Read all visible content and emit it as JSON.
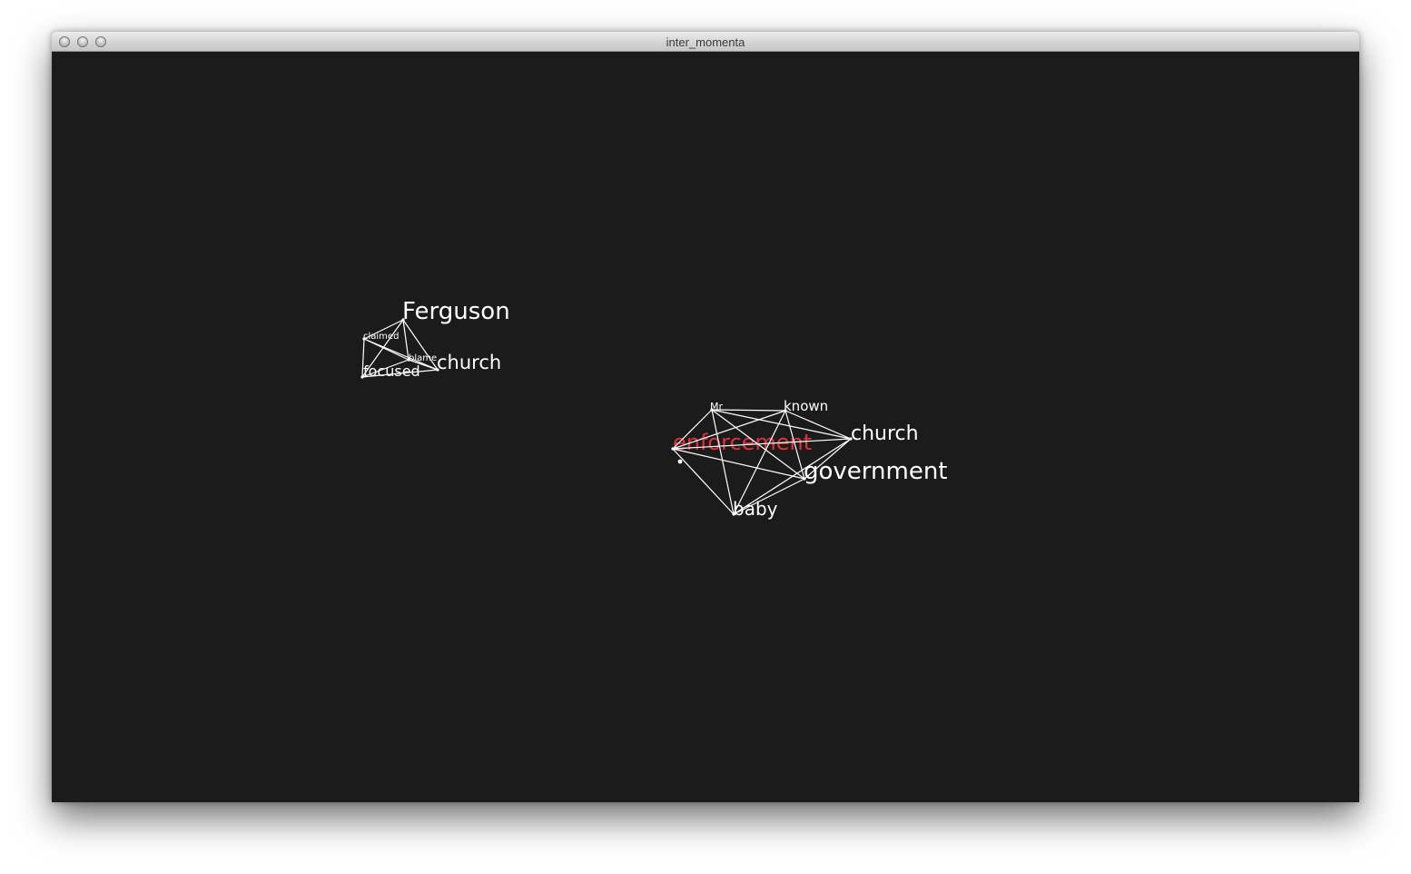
{
  "window": {
    "title": "inter_momenta"
  },
  "colors": {
    "canvas_bg": "#1b1b1b",
    "word": "#ffffff",
    "edge": "#ffffff",
    "highlight": "#e0313a"
  },
  "clusters": [
    {
      "id": "cluster-left",
      "words": [
        {
          "key": "ferguson",
          "label": "Ferguson"
        },
        {
          "key": "claimed",
          "label": "claimed"
        },
        {
          "key": "blame",
          "label": "blame"
        },
        {
          "key": "focused",
          "label": "focused"
        },
        {
          "key": "church",
          "label": "church"
        }
      ]
    },
    {
      "id": "cluster-right",
      "words": [
        {
          "key": "mr",
          "label": "Mr"
        },
        {
          "key": "known",
          "label": "known"
        },
        {
          "key": "church",
          "label": "church"
        },
        {
          "key": "enforcement",
          "label": "enforcement",
          "highlighted": true
        },
        {
          "key": "government",
          "label": "government"
        },
        {
          "key": "baby",
          "label": "baby"
        }
      ]
    }
  ]
}
